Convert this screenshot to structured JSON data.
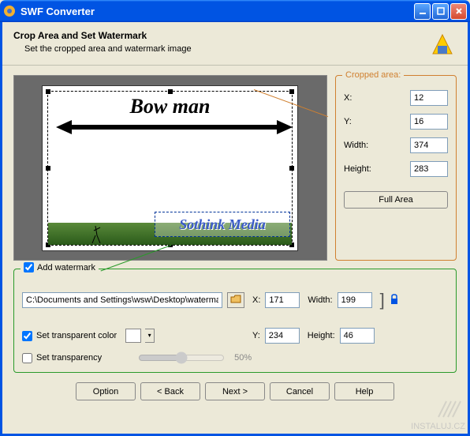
{
  "window": {
    "title": "SWF Converter"
  },
  "header": {
    "title": "Crop Area and Set Watermark",
    "subtitle": "Set the cropped area and watermark image"
  },
  "preview": {
    "bowman_text": "Bow man",
    "watermark_text": "Sothink Media"
  },
  "crop": {
    "group_label": "Cropped area:",
    "x_label": "X:",
    "x_value": "12",
    "y_label": "Y:",
    "y_value": "16",
    "w_label": "Width:",
    "w_value": "374",
    "h_label": "Height:",
    "h_value": "283",
    "full_area_btn": "Full Area"
  },
  "watermark": {
    "add_label": "Add watermark",
    "path": "C:\\Documents and Settings\\wsw\\Desktop\\watermark.",
    "x_label": "X:",
    "x_value": "171",
    "y_label": "Y:",
    "y_value": "234",
    "w_label": "Width:",
    "w_value": "199",
    "h_label": "Height:",
    "h_value": "46",
    "transparent_color_label": "Set transparent color",
    "transparency_label": "Set transparency",
    "transparency_pct": "50%"
  },
  "buttons": {
    "option": "Option",
    "back": "< Back",
    "next": "Next >",
    "cancel": "Cancel",
    "help": "Help"
  },
  "footer_brand": "INSTALUJ.CZ"
}
